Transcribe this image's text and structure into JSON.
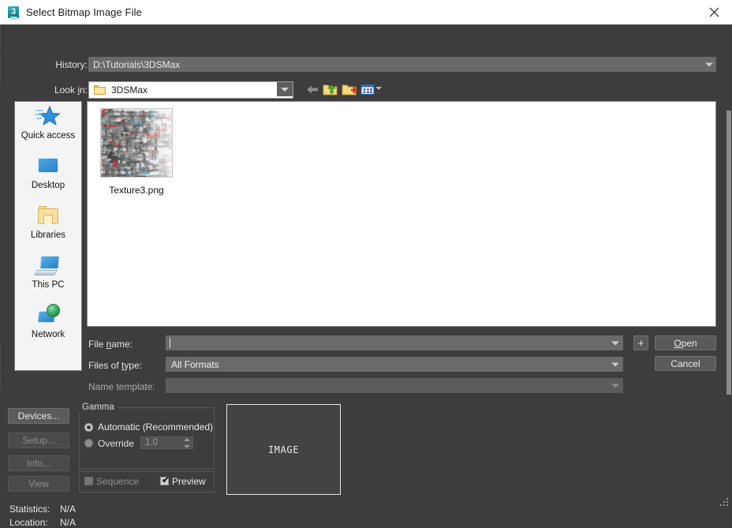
{
  "window": {
    "title": "Select Bitmap Image File",
    "app_icon": "3dsmax-icon",
    "icon_glyph": "3",
    "close_label": "×"
  },
  "history": {
    "label": "History:",
    "value": "D:\\Tutorials\\3DSMax"
  },
  "lookin": {
    "label_prefix": "Look ",
    "label_accel": "i",
    "label_suffix": "n:",
    "value": "3DSMax"
  },
  "toolbar": {
    "back": "back-arrow-icon",
    "up": "up-one-level-icon",
    "new_folder": "new-folder-icon",
    "views": "views-menu-icon"
  },
  "places": [
    {
      "label": "Quick access",
      "icon": "star-icon"
    },
    {
      "label": "Desktop",
      "icon": "monitor-icon"
    },
    {
      "label": "Libraries",
      "icon": "folder-icon"
    },
    {
      "label": "This PC",
      "icon": "computer-icon"
    },
    {
      "label": "Network",
      "icon": "network-globe-icon"
    }
  ],
  "files": [
    {
      "name": "Texture3.png",
      "thumb": "circuit-texture-thumbnail"
    }
  ],
  "fields": {
    "file_name_label_prefix": "File ",
    "file_name_label_accel": "n",
    "file_name_label_suffix": "ame:",
    "file_name_value": "",
    "files_of_type_label_prefix": "Files of ",
    "files_of_type_label_accel": "t",
    "files_of_type_label_suffix": "ype:",
    "files_of_type_value": "All Formats",
    "name_template_label": "Name template:",
    "name_template_value": ""
  },
  "buttons": {
    "plus": "+",
    "open_prefix": "",
    "open_accel": "O",
    "open_suffix": "pen",
    "cancel": "Cancel",
    "devices": "Devices...",
    "setup": "Setup...",
    "info": "Info...",
    "view": "View"
  },
  "gamma": {
    "legend": "Gamma",
    "automatic_label": "Automatic (Recommended)",
    "override_label": "Override",
    "override_value": "1.0",
    "selected": "automatic"
  },
  "options": {
    "sequence_label": "Sequence",
    "sequence_checked": false,
    "sequence_enabled": false,
    "preview_label": "Preview",
    "preview_checked": true,
    "preview_tick": "✔"
  },
  "preview": {
    "placeholder": "IMAGE"
  },
  "statistics": {
    "statistics_label": "Statistics:",
    "statistics_value": "N/A",
    "location_label": "Location:",
    "location_value": "N/A"
  },
  "colors": {
    "dialog_bg": "#3d3d3d",
    "titlebar_bg": "#ffffff",
    "field_bg": "#6a6a6a",
    "list_bg": "#ffffff",
    "button_bg": "#5a5a5a",
    "accent_folder": "#fbe5a6"
  }
}
